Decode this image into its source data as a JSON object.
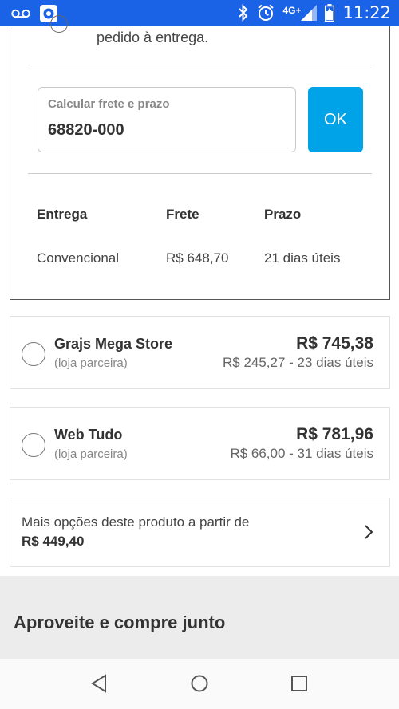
{
  "status_bar": {
    "network": "4G+",
    "time": "11:22"
  },
  "delivery": {
    "partial_text": "pedido à entrega.",
    "cep_label": "Calcular frete e prazo",
    "cep_value": "68820-000",
    "ok_label": "OK",
    "headers": {
      "entrega": "Entrega",
      "frete": "Frete",
      "prazo": "Prazo"
    },
    "row": {
      "entrega": "Convencional",
      "frete": "R$ 648,70",
      "prazo": "21 dias úteis"
    }
  },
  "sellers": [
    {
      "name": "Grajs Mega Store",
      "sub": "(loja parceira)",
      "price": "R$ 745,38",
      "shipping": "R$ 245,27 - 23 dias úteis"
    },
    {
      "name": "Web Tudo",
      "sub": "(loja parceira)",
      "price": "R$ 781,96",
      "shipping": "R$ 66,00 - 31 dias úteis"
    }
  ],
  "more_options": {
    "text": "Mais opções deste produto a partir de",
    "price": "R$ 449,40"
  },
  "section": {
    "title": "Aproveite e compre junto"
  },
  "colors": {
    "status_bar": "#1a62e6",
    "ok_button": "#00a3e8"
  }
}
